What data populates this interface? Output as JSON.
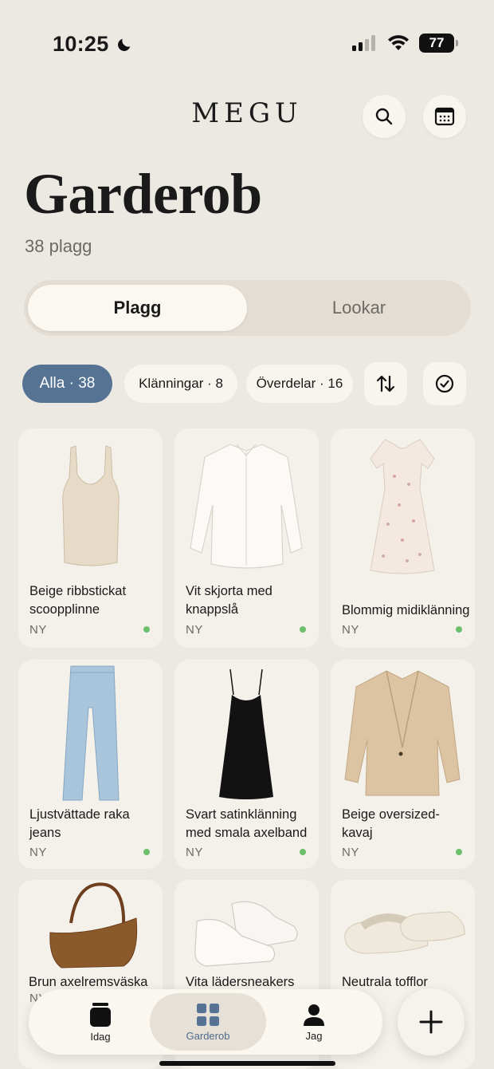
{
  "status": {
    "time": "10:25",
    "battery": "77"
  },
  "header": {
    "brand": "MEGU"
  },
  "page": {
    "title": "Garderob",
    "count": "38 plagg"
  },
  "segments": {
    "active": "Plagg",
    "inactive": "Lookar"
  },
  "filters": {
    "all": "Alla · 38",
    "dresses": "Klänningar · 8",
    "tops": "Överdelar · 16"
  },
  "items": [
    {
      "name": "Beige ribbstickat scoopplinne",
      "tag": "NY"
    },
    {
      "name": "Vit skjorta med knappslå",
      "tag": "NY"
    },
    {
      "name": "Blommig midiklänning",
      "tag": "NY"
    },
    {
      "name": "Ljustvättade raka jeans",
      "tag": "NY"
    },
    {
      "name": "Svart satinklänning med smala axelband",
      "tag": "NY"
    },
    {
      "name": "Beige oversized-kavaj",
      "tag": "NY"
    },
    {
      "name": "Brun axelremsväska",
      "tag": "NY"
    },
    {
      "name": "Vita lädersneakers",
      "tag": ""
    },
    {
      "name": "Neutrala tofflor",
      "tag": ""
    }
  ],
  "nav": {
    "today": "Idag",
    "wardrobe": "Garderob",
    "me": "Jag"
  },
  "colors": {
    "accent": "#567394",
    "new_dot": "#6cbf6c",
    "background": "#ece8e2"
  }
}
